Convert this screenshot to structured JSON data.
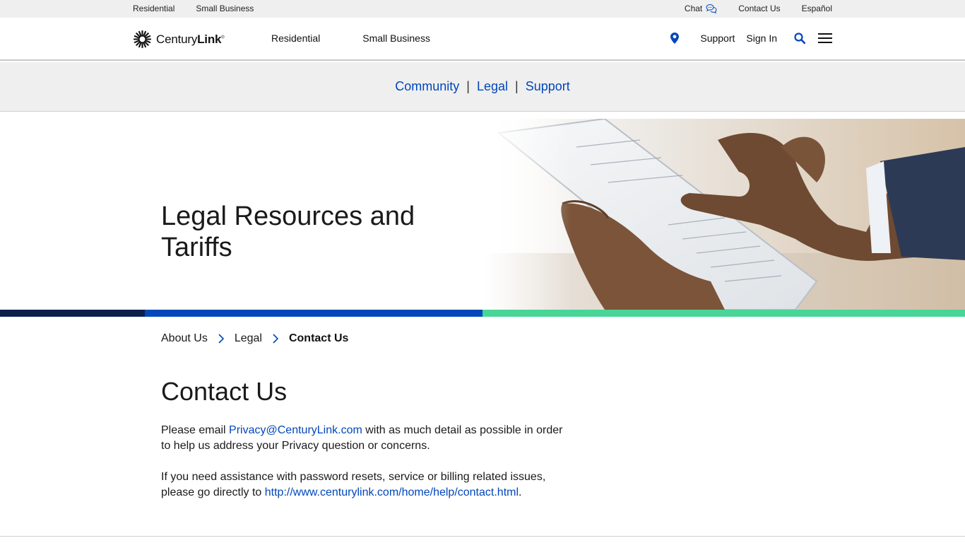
{
  "utility_bar": {
    "left": [
      "Residential",
      "Small Business"
    ],
    "chat_label": "Chat",
    "contact_label": "Contact Us",
    "language_label": "Español"
  },
  "header": {
    "brand_name": "CenturyLink",
    "nav": [
      "Residential",
      "Small Business"
    ],
    "support_label": "Support",
    "signin_label": "Sign In"
  },
  "sub_nav": {
    "items": [
      "Community",
      "Legal",
      "Support"
    ],
    "separator": "|"
  },
  "hero": {
    "title": "Legal Resources and Tariffs"
  },
  "breadcrumb": {
    "items": [
      "About Us",
      "Legal",
      "Contact Us"
    ]
  },
  "content": {
    "title": "Contact Us",
    "para1_prefix": "Please email ",
    "para1_link": "Privacy@CenturyLink.com",
    "para1_suffix": " with as much detail as possible in order to help us address your Privacy question or concerns.",
    "para2_prefix": "If you need assistance with password resets, service or billing related issues, please go directly to ",
    "para2_link": "http://www.centurylink.com/home/help/contact.html",
    "para2_suffix": "."
  },
  "colors": {
    "brand_blue": "#0047bb",
    "navy": "#0b1f4f",
    "green": "#48d597",
    "grey_bar": "#efefef"
  }
}
